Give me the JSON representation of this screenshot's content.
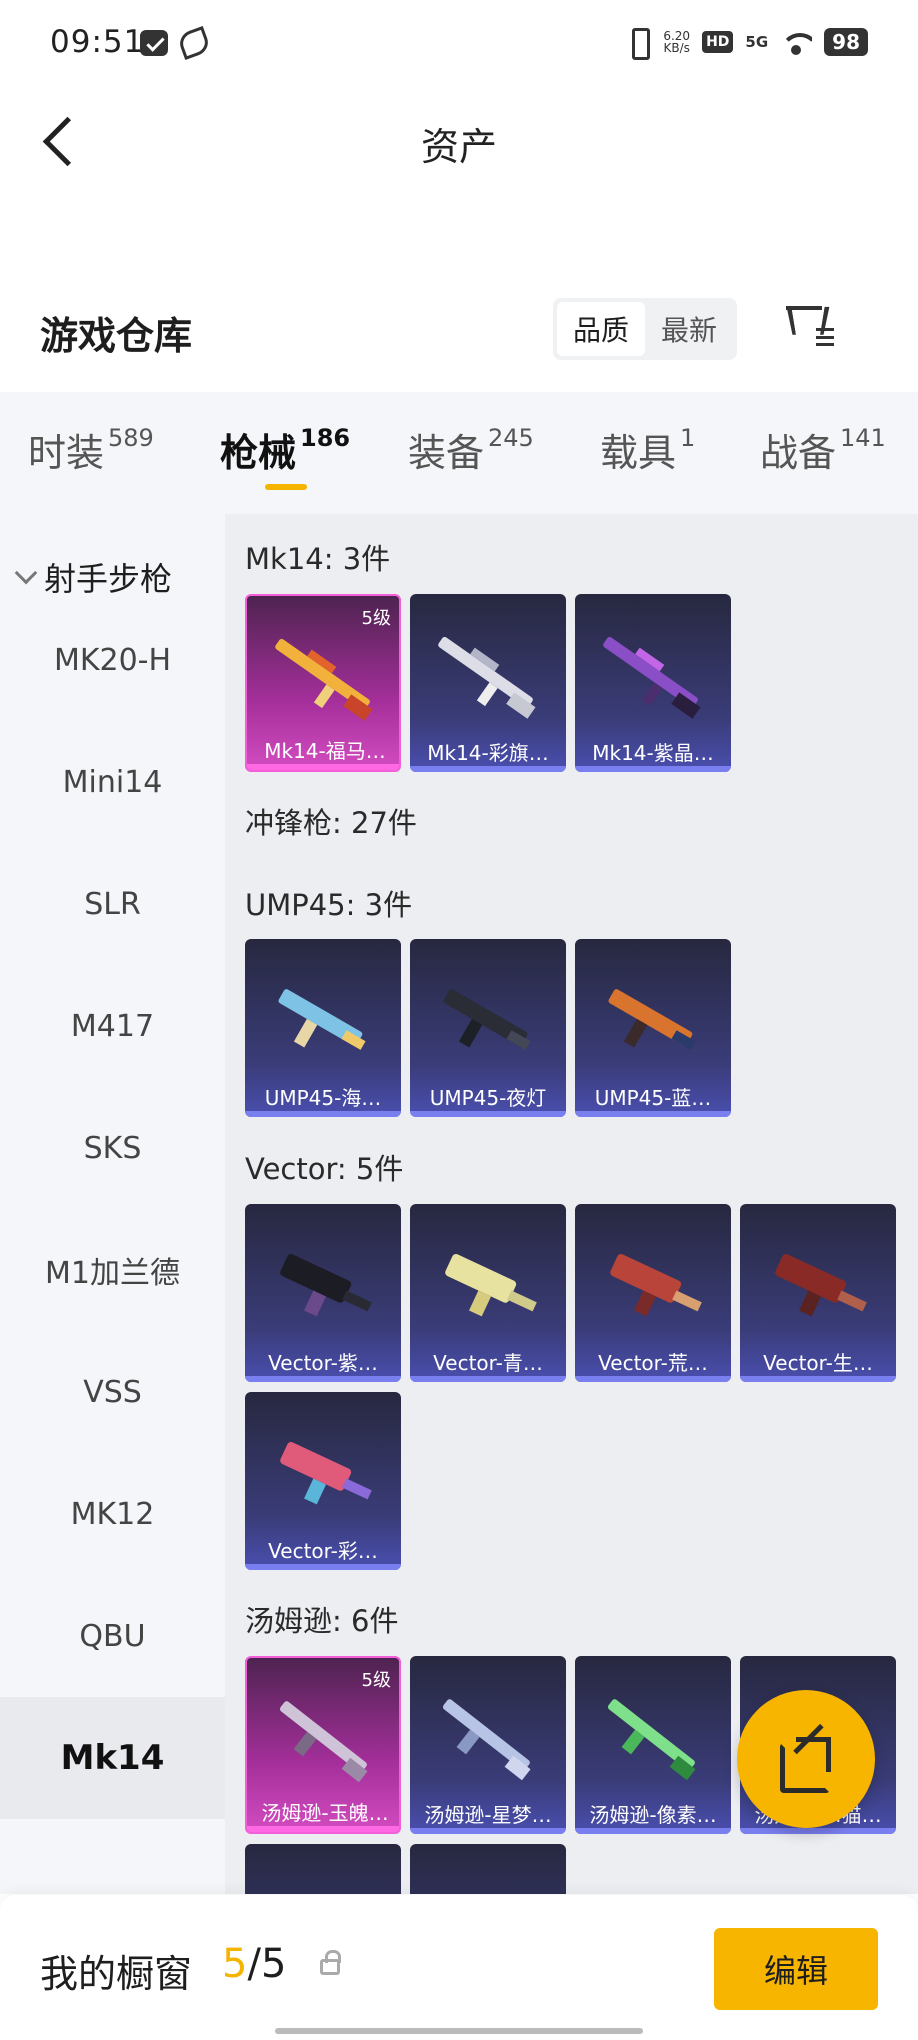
{
  "status_bar": {
    "time": "09:51",
    "speed_value": "6.20",
    "speed_unit": "KB/s",
    "hd": "HD",
    "network": "5G",
    "battery": "98"
  },
  "header": {
    "title": "资产"
  },
  "warehouse": {
    "title": "游戏仓库",
    "sort_options": [
      "品质",
      "最新"
    ],
    "active_sort": "品质"
  },
  "categories": [
    {
      "label": "时装",
      "count": "589"
    },
    {
      "label": "枪械",
      "count": "186"
    },
    {
      "label": "装备",
      "count": "245"
    },
    {
      "label": "载具",
      "count": "1"
    },
    {
      "label": "战备",
      "count": "141"
    }
  ],
  "active_category": "枪械",
  "sidebar": {
    "group": "射手步枪",
    "items": [
      "MK20-H",
      "Mini14",
      "SLR",
      "M417",
      "SKS",
      "M1加兰德",
      "VSS",
      "MK12",
      "QBU",
      "Mk14"
    ],
    "active": "Mk14"
  },
  "sections": [
    {
      "title": "Mk14: 3件",
      "items": [
        {
          "name": "Mk14-福马…",
          "level": "5级",
          "rarity": "legendary"
        },
        {
          "name": "Mk14-彩旗…",
          "rarity": "epic"
        },
        {
          "name": "Mk14-紫晶…",
          "rarity": "epic"
        }
      ]
    },
    {
      "title": "冲锋枪: 27件",
      "items": []
    },
    {
      "title": "UMP45: 3件",
      "items": [
        {
          "name": "UMP45-海…",
          "rarity": "epic"
        },
        {
          "name": "UMP45-夜灯",
          "rarity": "epic"
        },
        {
          "name": "UMP45-蓝…",
          "rarity": "epic"
        }
      ]
    },
    {
      "title": "Vector: 5件",
      "items": [
        {
          "name": "Vector-紫…",
          "rarity": "epic"
        },
        {
          "name": "Vector-青…",
          "rarity": "epic"
        },
        {
          "name": "Vector-荒…",
          "rarity": "epic"
        },
        {
          "name": "Vector-生…",
          "rarity": "epic"
        },
        {
          "name": "Vector-彩…",
          "rarity": "epic"
        }
      ]
    },
    {
      "title": "汤姆逊: 6件",
      "items": [
        {
          "name": "汤姆逊-玉魄…",
          "level": "5级",
          "rarity": "legendary"
        },
        {
          "name": "汤姆逊-星梦…",
          "rarity": "epic"
        },
        {
          "name": "汤姆逊-像素…",
          "rarity": "epic"
        },
        {
          "name": "汤姆逊-…猫…",
          "rarity": "epic"
        }
      ]
    }
  ],
  "bottom_bar": {
    "label": "我的橱窗",
    "current": "5",
    "separator": "/",
    "max": "5",
    "edit_label": "编辑"
  },
  "colors": {
    "accent": "#f5b400",
    "card_epic": "#3a3c78",
    "card_legendary": "#a42f9a"
  }
}
